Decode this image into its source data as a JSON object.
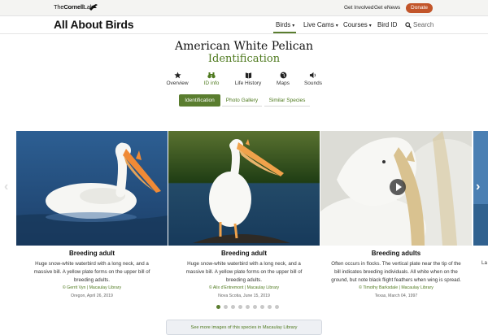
{
  "topbar": {
    "logo_prefix": "The",
    "logo_main": "Cornell",
    "logo_suffix": "Lab",
    "get_involved": "Get Involved",
    "get_enews": "Get eNews",
    "donate": "Donate"
  },
  "nav": {
    "brand": "All About Birds",
    "items": [
      {
        "label": "Birds",
        "dropdown": true
      },
      {
        "label": "Live Cams",
        "dropdown": true
      },
      {
        "label": "Courses",
        "dropdown": true
      },
      {
        "label": "Bird ID",
        "dropdown": false
      }
    ],
    "search_label": "Search"
  },
  "page": {
    "title": "American White Pelican",
    "subtitle": "Identification"
  },
  "section_tabs": [
    {
      "label": "Overview",
      "icon": "star-icon",
      "active": false
    },
    {
      "label": "ID info",
      "icon": "binoculars-icon",
      "active": true
    },
    {
      "label": "Life History",
      "icon": "book-icon",
      "active": false
    },
    {
      "label": "Maps",
      "icon": "globe-icon",
      "active": false
    },
    {
      "label": "Sounds",
      "icon": "speaker-icon",
      "active": false
    }
  ],
  "pill_tabs": [
    {
      "label": "Identification",
      "active": true
    },
    {
      "label": "Photo Gallery",
      "active": false
    },
    {
      "label": "Similar Species",
      "active": false
    }
  ],
  "gallery": [
    {
      "title": "Breeding adult",
      "desc_1": "Huge snow-white waterbird with a long neck, and a",
      "desc_2": "massive bill. A yellow plate forms on the upper bill of",
      "desc_3": "breeding adults.",
      "credit": "© Gerrit Vyn | Macaulay Library",
      "location": "Oregon, April 26, 2019"
    },
    {
      "title": "Breeding adult",
      "desc_1": "Huge snow-white waterbird with a long neck, and a",
      "desc_2": "massive bill. A yellow plate forms on the upper bill of",
      "desc_3": "breeding adults.",
      "credit": "© Alix d'Entremont | Macaulay Library",
      "location": "Nova Scotia, June 15, 2019"
    },
    {
      "title": "Breeding adults",
      "desc_1": "Often occurs in flocks. The vertical plate near the tip of the",
      "desc_2": "bill indicates breeding individuals. All white when on the",
      "desc_3": "ground, but note black flight feathers when wing is spread.",
      "credit": "© Timothy Barksdale | Macaulay Library",
      "location": "Texas, March 04, 1997"
    }
  ],
  "partial_caption": "La",
  "carousel": {
    "dot_count": 9,
    "active_index": 0
  },
  "more_link": "See more images of this species in Macaulay Library",
  "colors": {
    "accent_green": "#5a7d2f",
    "donate_orange": "#c2552a"
  }
}
